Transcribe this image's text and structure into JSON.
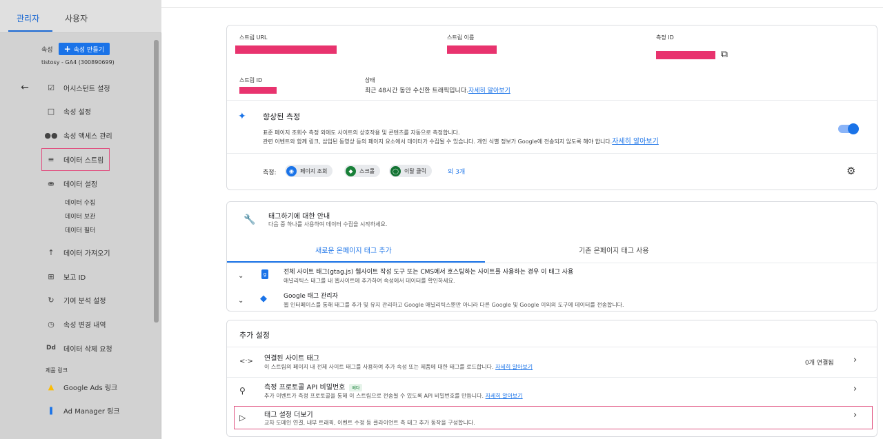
{
  "sidebar": {
    "tabs": [
      {
        "label": "관리자"
      },
      {
        "label": "사용자"
      }
    ],
    "property_label": "속성",
    "create_property_label": "속성 만들기",
    "property_name": "tistosy - GA4 (300890699)",
    "items": [
      {
        "label": "어시스턴트 설정",
        "icon": "checkbox-icon"
      },
      {
        "label": "속성 설정",
        "icon": "window-icon"
      },
      {
        "label": "속성 액세스 관리",
        "icon": "people-icon"
      },
      {
        "label": "데이터 스트림",
        "icon": "streams-icon"
      },
      {
        "label": "데이터 설정",
        "icon": "database-icon"
      },
      {
        "label": "데이터 가져오기",
        "icon": "upload-icon"
      },
      {
        "label": "보고 ID",
        "icon": "report-id-icon"
      },
      {
        "label": "기여 분석 설정",
        "icon": "attribution-icon"
      },
      {
        "label": "속성 변경 내역",
        "icon": "history-icon"
      },
      {
        "label": "데이터 삭제 요청",
        "icon": "delete-dd-icon"
      }
    ],
    "sub_items": [
      "데이터 수집",
      "데이터 보관",
      "데이터 필터"
    ],
    "product_links_section": "제품 링크",
    "product_links": [
      {
        "label": "Google Ads 링크",
        "icon": "google-ads-icon"
      },
      {
        "label": "Ad Manager 링크",
        "icon": "ad-manager-icon"
      }
    ]
  },
  "stream": {
    "url_label": "스트림 URL",
    "name_label": "스트림 이름",
    "measurement_id_label": "측정 ID",
    "stream_id_label": "스트림 ID",
    "status_label": "상태",
    "status_text": "최근 48시간 동안 수신한 트래픽입니다.",
    "learn_more": "자세히 알아보기",
    "redact_color": "#e8336e"
  },
  "enhanced": {
    "title": "향상된 측정",
    "desc1": "표준 페이지 조회수 측정 외에도 사이트의 상호작용 및 콘텐츠를 자동으로 측정합니다.",
    "desc2": "관련 이벤트와 함께 링크, 삽입된 동영상 등의 페이지 요소에서 데이터가 수집될 수 있습니다. 개인 식별 정보가 Google에 전송되지 않도록 해야 합니다.",
    "learn_more": "자세히 알아보기",
    "measure_label": "측정:",
    "chips": [
      {
        "label": "페이지 조회",
        "icon": "eye-icon",
        "color": "#1a73e8"
      },
      {
        "label": "스크롤",
        "icon": "scroll-icon",
        "color": "#188038"
      },
      {
        "label": "이탈 클릭",
        "icon": "mouse-icon",
        "color": "#137333"
      }
    ],
    "more": "외 3개"
  },
  "tagging": {
    "title": "태그하기에 대한 안내",
    "subtitle": "다음 중 하나를 사용하여 데이터 수집을 시작하세요.",
    "tabs": [
      {
        "label": "새로운 온페이지 태그 추가"
      },
      {
        "label": "기존 온페이지 태그 사용"
      }
    ],
    "options": [
      {
        "title": "전체 사이트 태그(gtag.js) 웹사이트 작성 도구 또는 CMS에서 호스팅하는 사이트를 사용하는 경우 이 태그 사용",
        "desc": "애널리틱스 태그를 내 웹사이트에 추가하여 속성에서 데이터를 확인하세요."
      },
      {
        "title": "Google 태그 관리자",
        "desc": "웹 인터페이스를 통해 태그를 추가 및 유지 관리하고 Google 애널리틱스뿐만 아니라 다른 Google 및 Google 이외의 도구에 데이터를 전송합니다."
      }
    ]
  },
  "additional": {
    "title": "추가 설정",
    "rows": [
      {
        "title": "연결된 사이트 태그",
        "desc": "이 스트림의 페이지 내 전체 사이트 태그를 사용하여 추가 속성 또는 제품에 대한 태그를 로드합니다.",
        "link": "자세히 알아보기",
        "right": "0개 연결됨",
        "icon": "code-icon"
      },
      {
        "title": "측정 프로토콜 API 비밀번호",
        "badge": "베타",
        "desc": "추가 이벤트가 측정 프로토콜을 통해 이 스트림으로 전송될 수 있도록 API 비밀번호를 만듭니다.",
        "link": "자세히 알아보기",
        "icon": "key-icon"
      },
      {
        "title": "태그 설정 더보기",
        "desc": "교차 도메인 연결, 내부 트래픽, 이벤트 수정 등 클라이언트 측 태그 추가 동작을 구성합니다.",
        "icon": "label-icon"
      }
    ]
  }
}
